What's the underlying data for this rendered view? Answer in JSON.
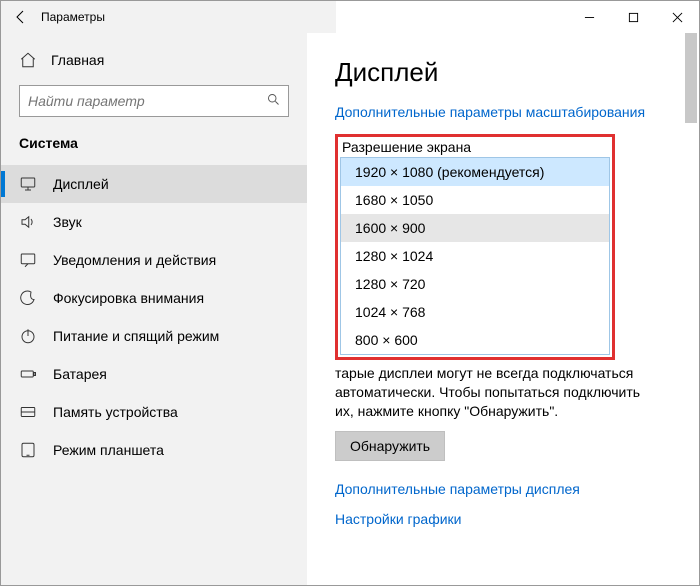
{
  "titlebar": {
    "title": "Параметры"
  },
  "sidebar": {
    "home": "Главная",
    "search_placeholder": "Найти параметр",
    "section": "Система",
    "items": [
      {
        "label": "Дисплей"
      },
      {
        "label": "Звук"
      },
      {
        "label": "Уведомления и действия"
      },
      {
        "label": "Фокусировка внимания"
      },
      {
        "label": "Питание и спящий режим"
      },
      {
        "label": "Батарея"
      },
      {
        "label": "Память устройства"
      },
      {
        "label": "Режим планшета"
      }
    ]
  },
  "content": {
    "title": "Дисплей",
    "scaling_link": "Дополнительные параметры масштабирования",
    "resolution_label": "Разрешение экрана",
    "options": [
      "1920 × 1080 (рекомендуется)",
      "1680 × 1050",
      "1600 × 900",
      "1280 × 1024",
      "1280 × 720",
      "1024 × 768",
      "800 × 600"
    ],
    "body_text_partial": "тарые дисплеи могут не всегда подключаться",
    "body_text_rest": "автоматически. Чтобы попытаться подключить их, нажмите кнопку \"Обнаружить\".",
    "detect_button": "Обнаружить",
    "adv_display_link": "Дополнительные параметры дисплея",
    "graphics_link": "Настройки графики"
  }
}
